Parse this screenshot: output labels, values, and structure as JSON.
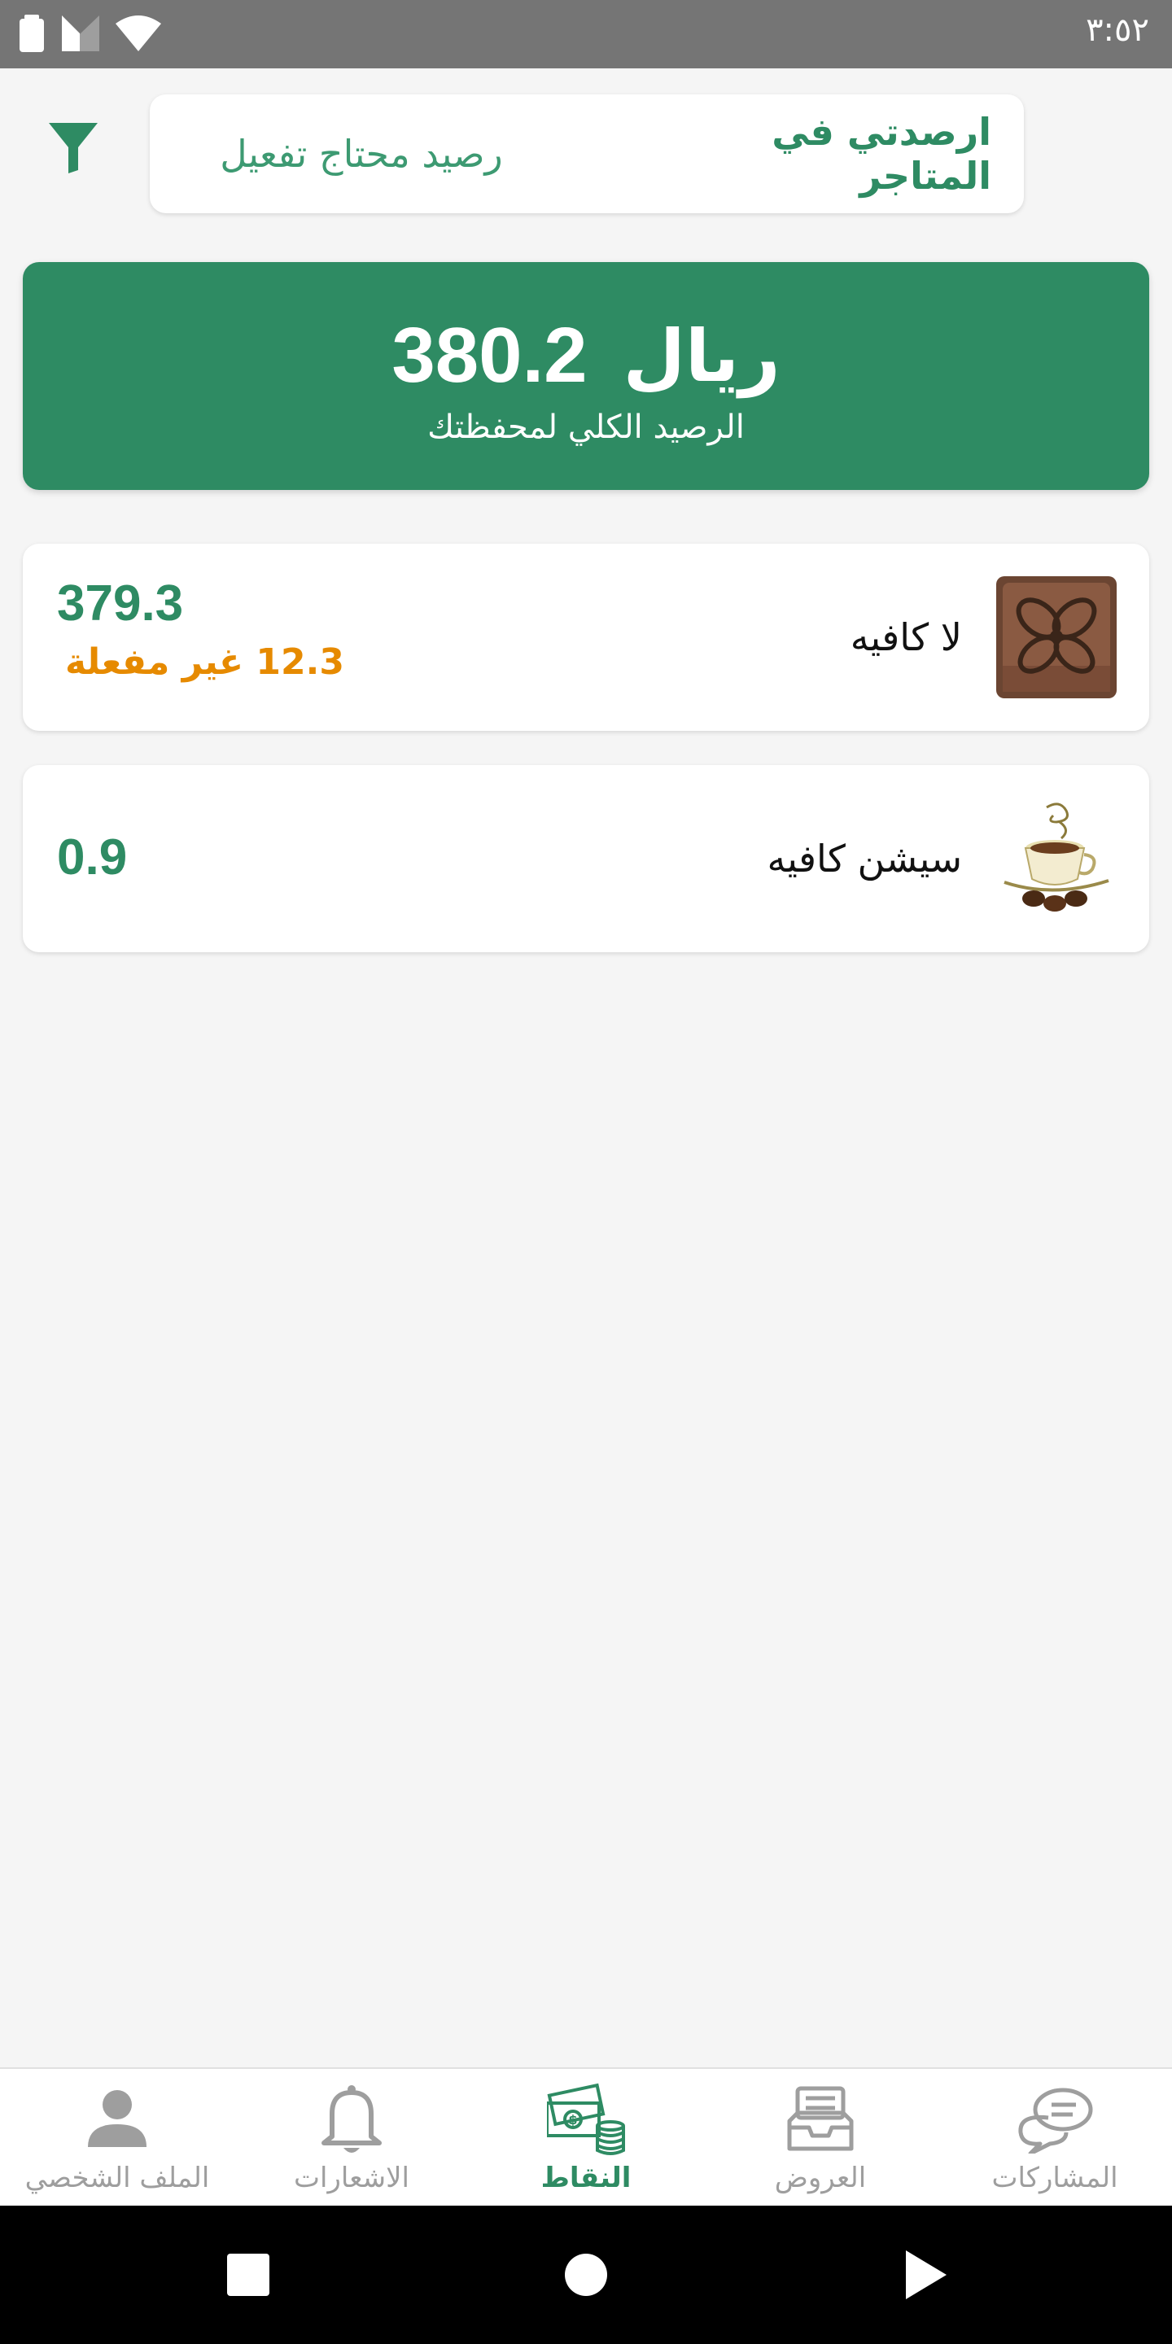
{
  "status_bar": {
    "time": "٣:٥٢",
    "icons": [
      "battery-icon",
      "signal-icon",
      "wifi-icon"
    ]
  },
  "header": {
    "filter_icon": "filter-icon",
    "tabs": [
      {
        "label": "ارصدتي في المتاجر",
        "active": true
      },
      {
        "label": "رصيد محتاج تفعيل",
        "active": false
      }
    ]
  },
  "summary": {
    "amount": "380.2",
    "currency": "ريال",
    "label": "الرصيد الكلي لمحفظتك"
  },
  "stores": [
    {
      "name": "لا كافيه",
      "balance": "379.3",
      "inactive_text": "12.3 غير مفعلة",
      "thumb_icon": "gift-box-icon"
    },
    {
      "name": "سيشن كافيه",
      "balance": "0.9",
      "thumb_icon": "coffee-cup-icon"
    }
  ],
  "bottom_nav": [
    {
      "label": "الملف الشخصي",
      "icon": "person-icon",
      "active": false
    },
    {
      "label": "الاشعارات",
      "icon": "bell-icon",
      "active": false
    },
    {
      "label": "النقاط",
      "icon": "money-coins-icon",
      "active": true
    },
    {
      "label": "العروض",
      "icon": "inbox-offers-icon",
      "active": false
    },
    {
      "label": "المشاركات",
      "icon": "chat-bubbles-icon",
      "active": false
    }
  ],
  "colors": {
    "primary": "#2e8b63",
    "warning": "#e68a00",
    "status_bar": "#757575",
    "inactive_nav": "#9e9e9e"
  }
}
